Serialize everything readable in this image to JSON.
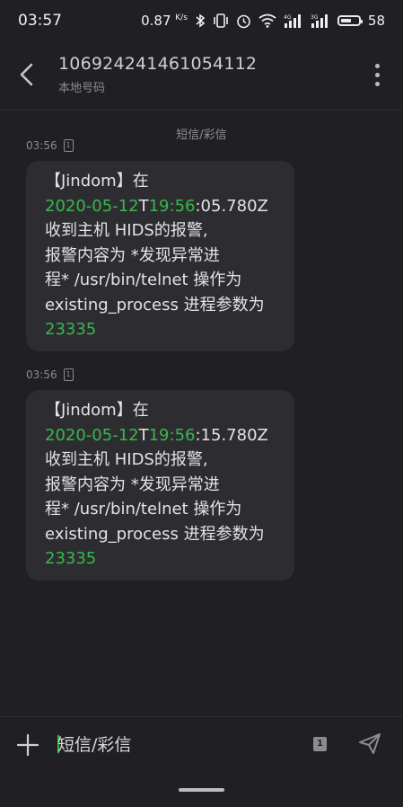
{
  "status_bar": {
    "time": "03:57",
    "network_speed": "0.87",
    "speed_unit": "K/s",
    "battery": "58"
  },
  "header": {
    "contact_number": "106924241461054112",
    "contact_subtitle": "本地号码"
  },
  "thread": {
    "channel_label": "短信/彩信",
    "messages": [
      {
        "time": "03:56",
        "sim": "1",
        "line1": "【Jindom】在",
        "date": "2020-05-12",
        "t_sep": "T",
        "hm": "19:56",
        "sec": ":05.780Z",
        "line3": "收到主机  HIDS的报警,",
        "line4": "报警内容为 *发现异常进",
        "line5": "程* /usr/bin/telnet 操作为",
        "line6": "existing_process 进程参数为",
        "code": "23335"
      },
      {
        "time": "03:56",
        "sim": "1",
        "line1": "【Jindom】在",
        "date": "2020-05-12",
        "t_sep": "T",
        "hm": "19:56",
        "sec": ":15.780Z",
        "line3": "收到主机  HIDS的报警,",
        "line4": "报警内容为 *发现异常进",
        "line5": "程* /usr/bin/telnet 操作为",
        "line6": "existing_process 进程参数为",
        "code": "23335"
      }
    ]
  },
  "composer": {
    "placeholder": "短信/彩信",
    "sim": "1"
  },
  "colors": {
    "background": "#202024",
    "bubble": "#2d2d31",
    "highlight": "#36b84a"
  }
}
